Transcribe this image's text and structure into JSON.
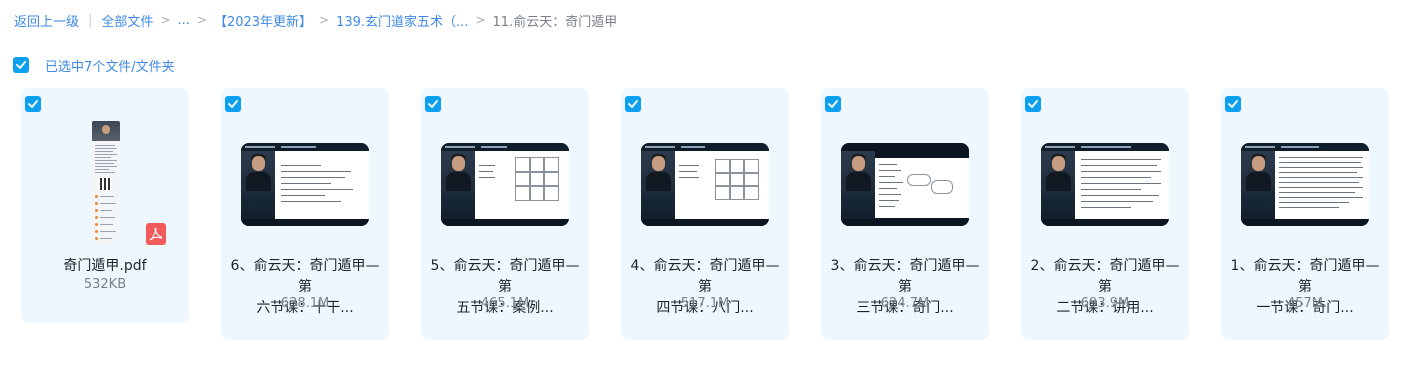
{
  "breadcrumb": {
    "back": "返回上一级",
    "all_files": "全部文件",
    "ellipsis": "...",
    "folder1": "【2023年更新】",
    "folder2": "139.玄门道家五术（...",
    "current": "11.俞云天：奇门遁甲"
  },
  "selection": {
    "label": "已选中7个文件/文件夹"
  },
  "colors": {
    "accent": "#0ea0f0",
    "link": "#3e8ae6",
    "card_bg": "#eef7fd",
    "pdf_red": "#f25b5b"
  },
  "files": [
    {
      "name_line1": "奇门遁甲.pdf",
      "name_line2": "",
      "size": "532KB",
      "type": "pdf",
      "icon": "pdf-icon"
    },
    {
      "name_line1": "6、俞云天：奇门遁甲—第",
      "name_line2": "六节课：十干...",
      "size": "638.1M",
      "type": "video"
    },
    {
      "name_line1": "5、俞云天：奇门遁甲—第",
      "name_line2": "五节课：案例...",
      "size": "465.1M",
      "type": "video"
    },
    {
      "name_line1": "4、俞云天：奇门遁甲—第",
      "name_line2": "四节课：八门...",
      "size": "517.1M",
      "type": "video"
    },
    {
      "name_line1": "3、俞云天：奇门遁甲—第",
      "name_line2": "三节课：奇门...",
      "size": "624.7M",
      "type": "video"
    },
    {
      "name_line1": "2、俞云天：奇门遁甲—第",
      "name_line2": "二节课：讲用...",
      "size": "693.9M",
      "type": "video"
    },
    {
      "name_line1": "1、俞云天：奇门遁甲—第",
      "name_line2": "一节课：奇门...",
      "size": "457M",
      "type": "video"
    }
  ]
}
